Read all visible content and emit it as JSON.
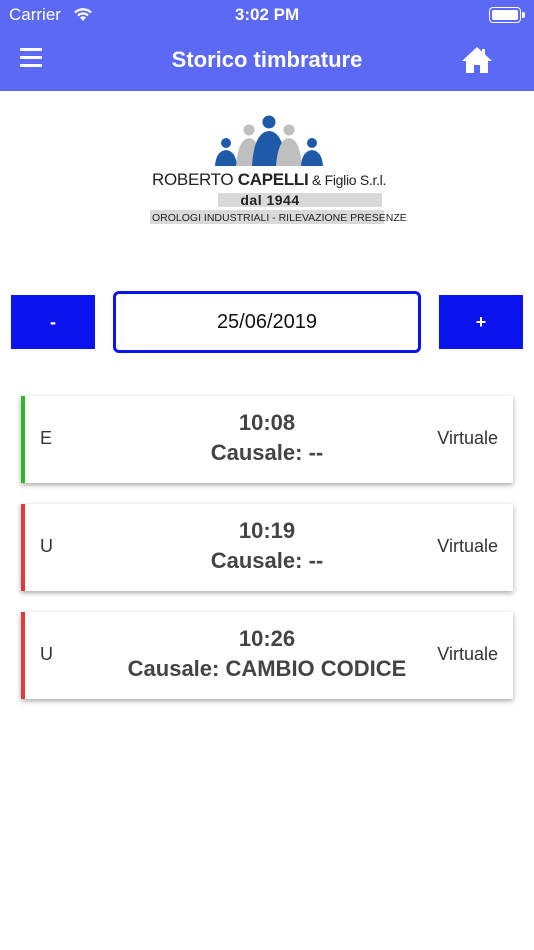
{
  "status_bar": {
    "carrier": "Carrier",
    "time": "3:02 PM",
    "icons": [
      "wifi-icon",
      "battery-icon"
    ]
  },
  "nav": {
    "title": "Storico timbrature",
    "menu_icon": "hamburger-menu-icon",
    "home_icon": "home-icon",
    "color": "#5b69f5"
  },
  "logo": {
    "name_regular": "ROBERTO ",
    "name_bold": "CAPELLI",
    "name_suffix": " & Figlio S.r.l.",
    "since": "dal 1944",
    "tagline": "OROLOGI INDUSTRIALI - RILEVAZIONE PRESENZE"
  },
  "date_picker": {
    "prev_label": "-",
    "next_label": "+",
    "date": "25/06/2019",
    "accent": "#0b13ee"
  },
  "entries": [
    {
      "type": "E",
      "time": "10:08",
      "cause": "Causale: --",
      "mode": "Virtuale",
      "status_color": "#2db52d"
    },
    {
      "type": "U",
      "time": "10:19",
      "cause": "Causale: --",
      "mode": "Virtuale",
      "status_color": "#e53935"
    },
    {
      "type": "U",
      "time": "10:26",
      "cause": "Causale: CAMBIO CODICE",
      "mode": "Virtuale",
      "status_color": "#e53935"
    }
  ]
}
